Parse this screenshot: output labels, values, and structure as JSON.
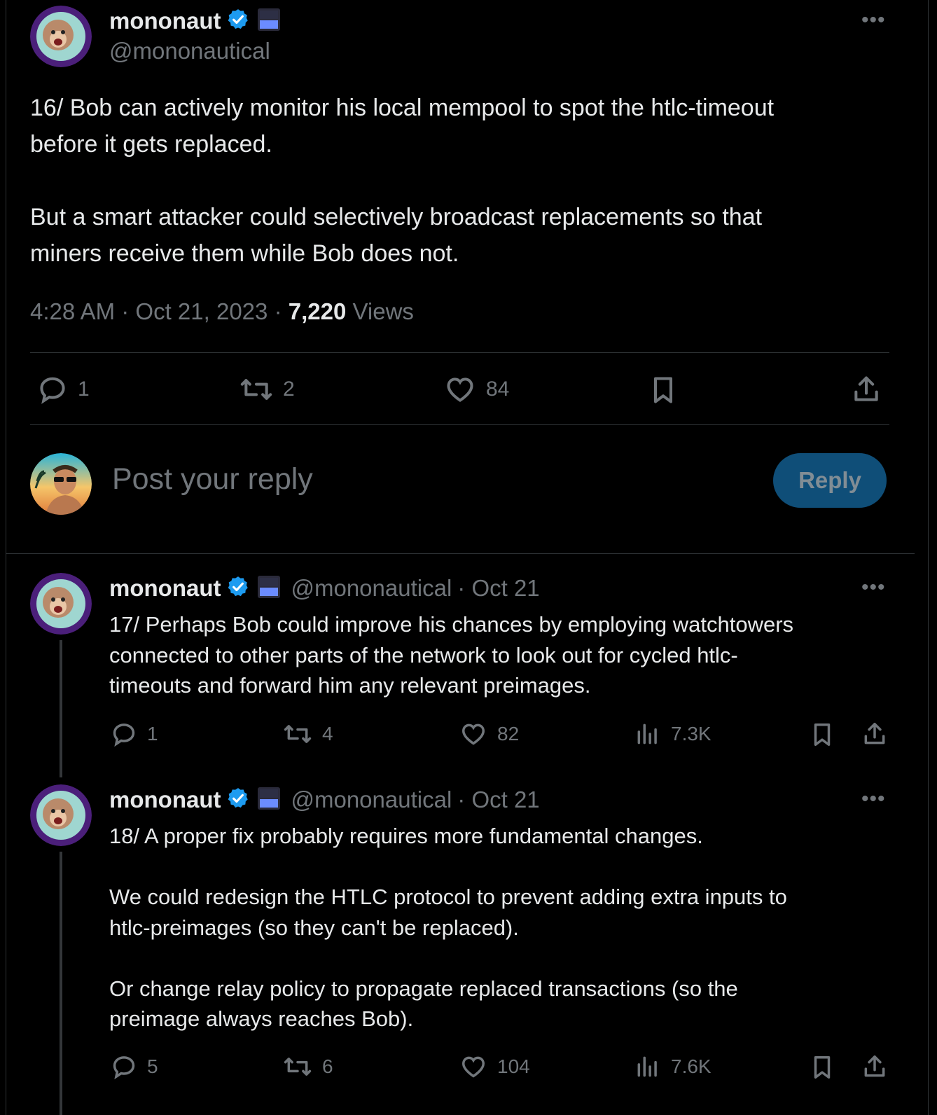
{
  "main_post": {
    "author_name": "mononaut",
    "author_handle": "@mononautical",
    "text": "16/ Bob can actively monitor his local mempool to spot the htlc-timeout\nbefore it gets replaced.\n\nBut a smart attacker could selectively broadcast replacements so that\nminers receive them while Bob does not.",
    "time": "4:28 AM",
    "date": "Oct 21, 2023",
    "views": "7,220",
    "views_label": "Views",
    "sep1": "·",
    "sep2": "·",
    "replies": "1",
    "reposts": "2",
    "likes": "84"
  },
  "composer": {
    "placeholder": "Post your reply",
    "button": "Reply"
  },
  "replies": [
    {
      "author_name": "mononaut",
      "author_handle": "@mononautical",
      "date": "· Oct 21",
      "text": "17/ Perhaps Bob could improve his chances by employing watchtowers\nconnected to other parts of the network to look out for cycled htlc-\ntimeouts and forward him any relevant preimages.",
      "replies": "1",
      "reposts": "4",
      "likes": "82",
      "views": "7.3K"
    },
    {
      "author_name": "mononaut",
      "author_handle": "@mononautical",
      "date": "· Oct 21",
      "text": "18/ A proper fix probably requires more fundamental changes.\n\nWe could redesign the HTLC protocol to prevent adding extra inputs to\nhtlc-preimages (so they can't be replaced).\n\nOr change relay policy to propagate replaced transactions (so the\npreimage always reaches Bob).",
      "replies": "5",
      "reposts": "6",
      "likes": "104",
      "views": "7.6K"
    }
  ],
  "more_label": "•••",
  "icons": {
    "verified": "verified-badge-icon",
    "affiliate": "affiliate-flag-icon",
    "reply": "reply-icon",
    "repost": "repost-icon",
    "like": "heart-icon",
    "views": "views-bar-icon",
    "bookmark": "bookmark-icon",
    "share": "share-icon"
  },
  "colors": {
    "background": "#000000",
    "text": "#e7e9ea",
    "secondary": "#71767b",
    "verified": "#1d9bf0",
    "reply_button_bg": "#0f4e78",
    "reply_button_text": "#818d95"
  }
}
